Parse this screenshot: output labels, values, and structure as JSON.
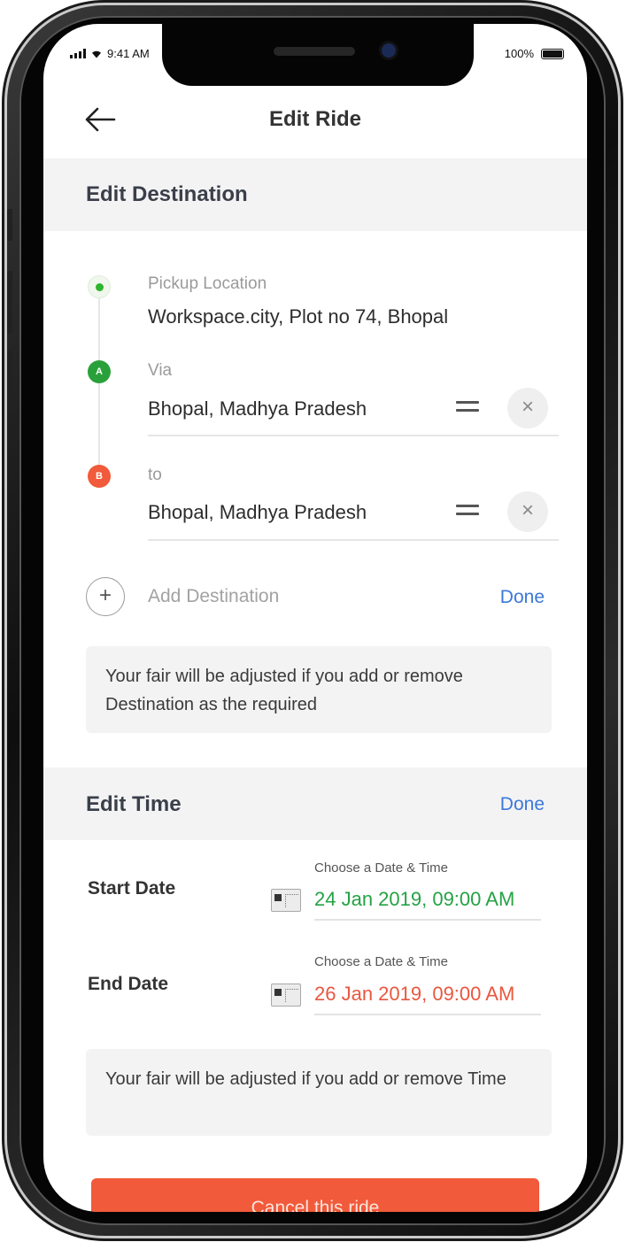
{
  "status_bar": {
    "time": "9:41 AM",
    "battery": "100%"
  },
  "header": {
    "title": "Edit Ride"
  },
  "destination_section": {
    "title": "Edit Destination",
    "pickup": {
      "label": "Pickup Location",
      "value": "Workspace.city, Plot no 74, Bhopal"
    },
    "via": {
      "badge": "A",
      "label": "Via",
      "value": "Bhopal, Madhya Pradesh"
    },
    "to": {
      "badge": "B",
      "label": "to",
      "value": "Bhopal, Madhya Pradesh"
    },
    "add_label": "Add Destination",
    "add_icon": "+",
    "done_label": "Done",
    "remove_icon": "×",
    "notice": "Your fair will be adjusted if you add or remove Destination as the required"
  },
  "time_section": {
    "title": "Edit Time",
    "done_label": "Done",
    "start": {
      "label": "Start Date",
      "caption": "Choose a Date & Time",
      "value": "24 Jan 2019, 09:00 AM"
    },
    "end": {
      "label": "End Date",
      "caption": "Choose a Date & Time",
      "value": "26 Jan 2019, 09:00 AM"
    },
    "notice": "Your fair will be adjusted if you add or remove Time"
  },
  "cancel_button": {
    "label": "Cancel this ride"
  },
  "colors": {
    "pickup_dot": "#2db52d",
    "via_badge": "#2aa03a",
    "to_badge": "#f15a3a",
    "start_date": "#25a244",
    "end_date": "#e9573f",
    "link": "#3c78d8",
    "cancel_button": "#f15a3a"
  }
}
